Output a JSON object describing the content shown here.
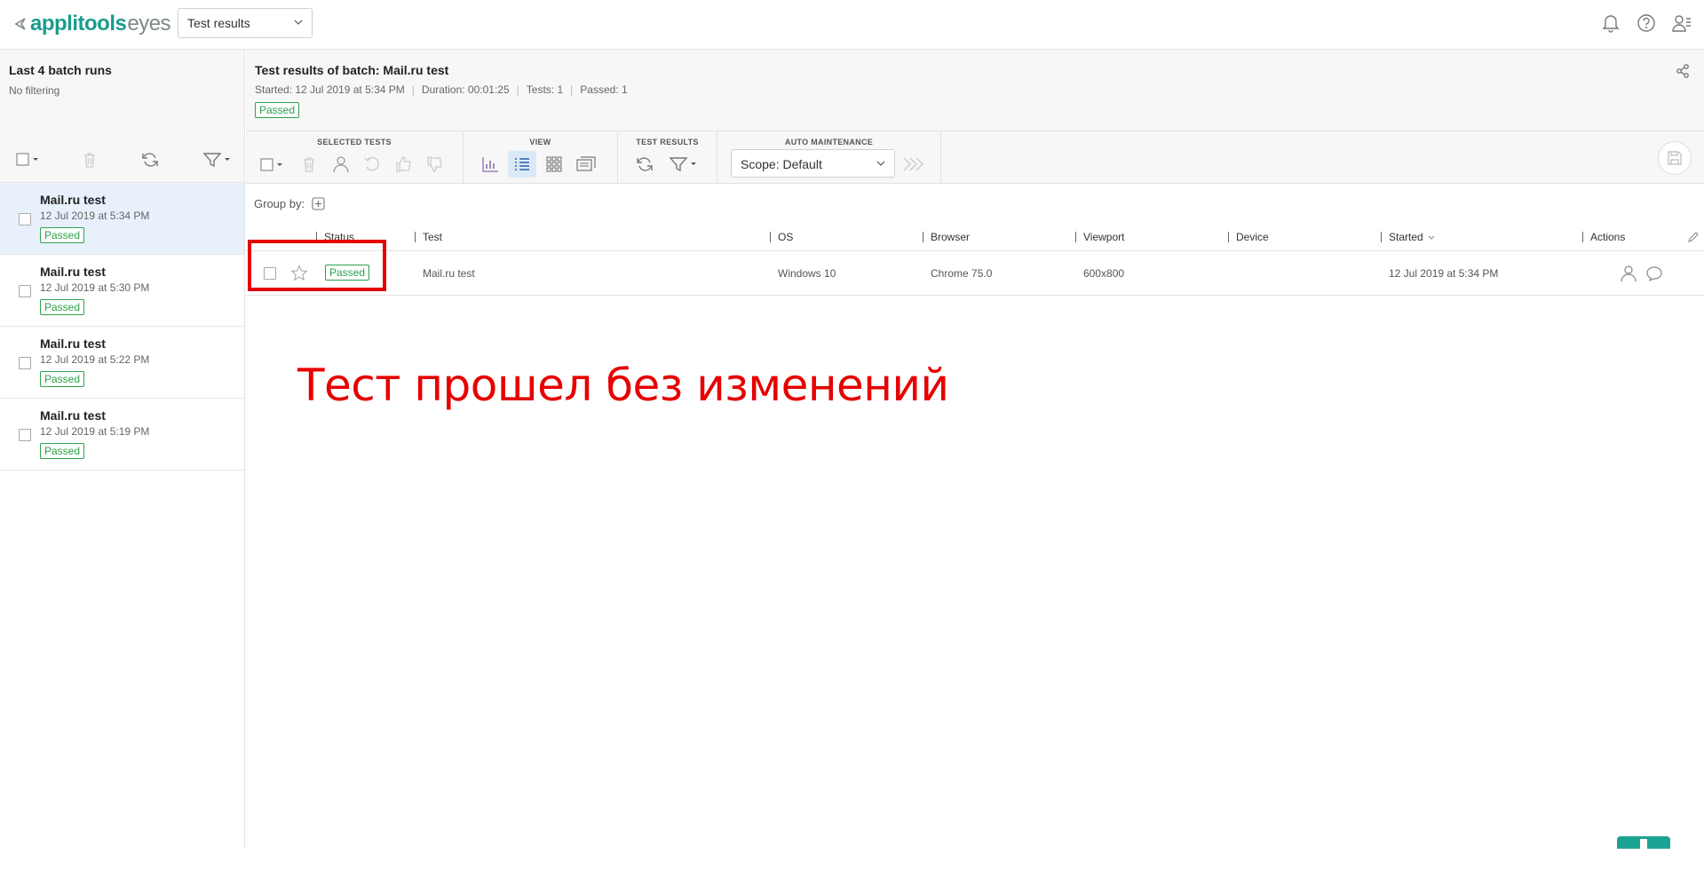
{
  "app": {
    "logo_main": "applitools",
    "logo_suffix": "eyes",
    "view_selector": "Test results"
  },
  "left_panel": {
    "title": "Last 4 batch runs",
    "subtitle": "No filtering",
    "batches": [
      {
        "name": "Mail.ru test",
        "date": "12 Jul 2019 at 5:34 PM",
        "status": "Passed",
        "selected": true
      },
      {
        "name": "Mail.ru test",
        "date": "12 Jul 2019 at 5:30 PM",
        "status": "Passed",
        "selected": false
      },
      {
        "name": "Mail.ru test",
        "date": "12 Jul 2019 at 5:22 PM",
        "status": "Passed",
        "selected": false
      },
      {
        "name": "Mail.ru test",
        "date": "12 Jul 2019 at 5:19 PM",
        "status": "Passed",
        "selected": false
      }
    ]
  },
  "header": {
    "title": "Test results of batch: Mail.ru test",
    "started": "Started: 12 Jul 2019 at 5:34 PM",
    "duration": "Duration: 00:01:25",
    "tests": "Tests: 1",
    "passed": "Passed: 1",
    "status": "Passed"
  },
  "toolbar": {
    "selected_tests_label": "SELECTED TESTS",
    "view_label": "VIEW",
    "test_results_label": "TEST RESULTS",
    "auto_maintenance_label": "AUTO MAINTENANCE",
    "scope_value": "Scope: Default"
  },
  "group_by_label": "Group by:",
  "table": {
    "columns": [
      "Status",
      "Test",
      "OS",
      "Browser",
      "Viewport",
      "Device",
      "Started",
      "Actions"
    ],
    "rows": [
      {
        "status": "Passed",
        "test": "Mail.ru test",
        "os": "Windows 10",
        "browser": "Chrome 75.0",
        "viewport": "600x800",
        "device": "",
        "started": "12 Jul 2019 at 5:34 PM"
      }
    ]
  },
  "annotation": {
    "text": "Тест прошел без изменений",
    "color": "#e60000"
  },
  "colors": {
    "brand": "#1a9c8d",
    "passed": "#2ea04a",
    "selected_row": "#e8f1fb"
  }
}
